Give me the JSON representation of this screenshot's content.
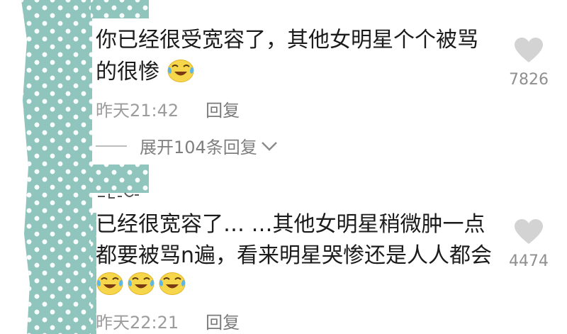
{
  "comments": [
    {
      "text_line1": "你已经很受宽容了，其他女明星个个被骂",
      "text_line2": "的很惨",
      "emoji": "crying-laughing-face",
      "time": "昨天21:42",
      "reply_label": "回复",
      "likes": "7826"
    },
    {
      "text_line1": "已经很宽容了… …其他女明星稍微肿一点",
      "text_line2": "都要被骂n遍，看来明星哭惨还是人人都会",
      "emoji": "crying-laughing-face",
      "time": "昨天22:21",
      "reply_label": "回复",
      "likes": "4474"
    }
  ],
  "expand_replies": {
    "label": "展开104条回复"
  },
  "colors": {
    "mask": "#8fc5bd",
    "text": "#1b1b1b",
    "meta": "#9c9c9c",
    "heart": "#d3d3d3"
  }
}
